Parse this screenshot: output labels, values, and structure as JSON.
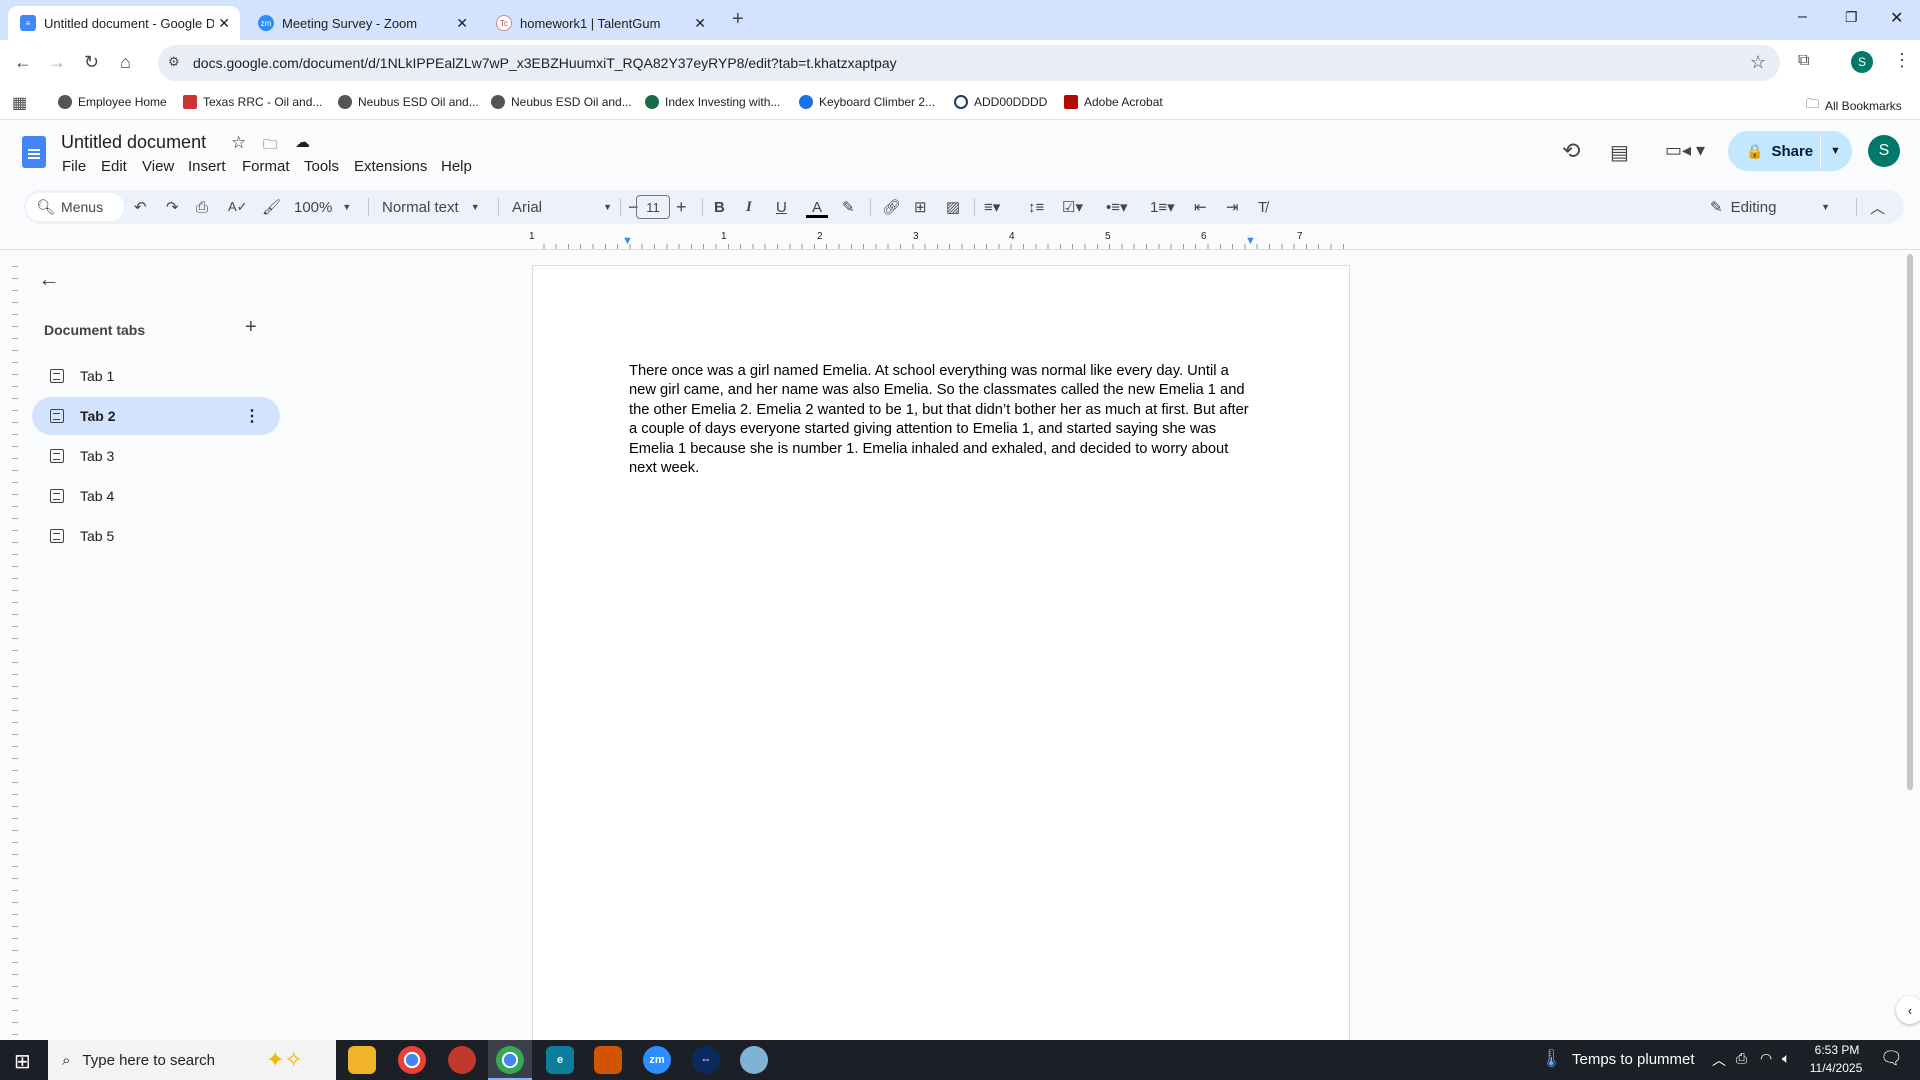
{
  "browser": {
    "tabs": [
      {
        "title": "Untitled document - Google Dc",
        "active": true
      },
      {
        "title": "Meeting Survey - Zoom",
        "active": false,
        "icon_text": "zm"
      },
      {
        "title": "homework1 | TalentGum",
        "active": false,
        "icon_text": "Tc"
      }
    ],
    "url": "docs.google.com/document/d/1NLkIPPEalZLw7wP_x3EBZHuumxiT_RQA82Y37eyRYP8/edit?tab=t.khatzxaptpay",
    "profile_initial": "S",
    "bookmarks": [
      "Employee Home",
      "Texas RRC - Oil and...",
      "Neubus ESD Oil and...",
      "Neubus ESD Oil and...",
      "Index Investing with...",
      "Keyboard Climber 2...",
      "ADD00DDDD",
      "Adobe Acrobat"
    ],
    "all_bookmarks": "All Bookmarks"
  },
  "docs": {
    "title": "Untitled document",
    "menus": [
      "File",
      "Edit",
      "View",
      "Insert",
      "Format",
      "Tools",
      "Extensions",
      "Help"
    ],
    "share_label": "Share",
    "avatar_initial": "S",
    "toolbar": {
      "search": "Menus",
      "zoom": "100%",
      "style": "Normal text",
      "font": "Arial",
      "font_size": "11",
      "mode": "Editing"
    },
    "ruler_labels": [
      "1",
      "1",
      "2",
      "3",
      "4",
      "5",
      "6",
      "7"
    ],
    "side_panel": {
      "heading": "Document tabs",
      "tabs": [
        "Tab 1",
        "Tab 2",
        "Tab 3",
        "Tab 4",
        "Tab 5"
      ],
      "selected": "Tab 2"
    },
    "body": "There once was a girl named Emelia. At school everything was normal like every day. Until a new girl came, and her name was also Emelia. So the classmates called the new  Emelia 1 and the other Emelia 2. Emelia 2 wanted to be 1, but that didn’t bother her as much at first. But after a couple of days everyone started giving attention to Emelia 1, and started saying she was Emelia 1 because she is number 1. Emelia inhaled and exhaled, and decided to worry about next week."
  },
  "taskbar": {
    "search_placeholder": "Type here to search",
    "weather": "Temps to plummet",
    "time": "6:53 PM",
    "date": "11/4/2025",
    "zoom_icon_text": "zm"
  },
  "colors": {
    "accent": "#0b57d0",
    "share_bg": "#c2e7ff",
    "avatar": "#00796b",
    "tab_sel": "#d3e3fd"
  }
}
